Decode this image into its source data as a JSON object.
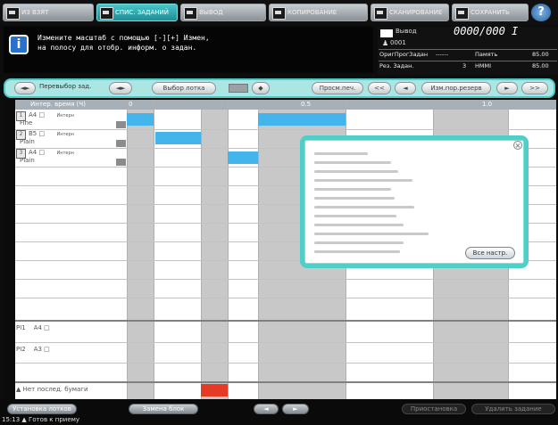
{
  "tabs": [
    {
      "label": "ИЗ ВЗЯТ",
      "active": false
    },
    {
      "label": "СПИС. ЗАДАНИЙ",
      "active": true
    },
    {
      "label": "ВЫВОД",
      "active": false
    },
    {
      "label": "КОПИРОВАНИЕ",
      "active": false
    },
    {
      "label": "СКАНИРОВАНИЕ",
      "active": false
    },
    {
      "label": "СОХРАНИТЬ",
      "active": false
    }
  ],
  "help_label": "?",
  "message": {
    "icon": "i",
    "line1": "Измените масштаб с помощью [-][+] Измен,",
    "line2": "на полосу для отобр. информ. о задан."
  },
  "status": {
    "output_label": "Вывод",
    "output_count": "0000/000 I",
    "user_id": "0001",
    "rows": [
      {
        "label": "ОригПрогЗадан",
        "value": "------",
        "label2": "Память",
        "value2": "85.00"
      },
      {
        "label": "Рез. Задан.",
        "value": "3",
        "label2": "HMMI",
        "value2": "85.00"
      }
    ]
  },
  "toolbar": {
    "reorder_label": "Перевыбор зад.",
    "paper_select_label": "Выбор лотка",
    "preview_label": "Просм.печ.",
    "zoom_label": "Изм.пор.резерв",
    "prev_icon": "arrow-left",
    "next_icon": "arrow-right"
  },
  "grid": {
    "header_label": "Интер. время (Ч)",
    "scale": [
      "0",
      "0.5",
      "1.0"
    ],
    "rows": [
      {
        "num": "1",
        "size": "A4",
        "type": "Fine",
        "tag": "Интерн"
      },
      {
        "num": "2",
        "size": "B5",
        "type": "Plain",
        "tag": "Интерн"
      },
      {
        "num": "3",
        "size": "A4",
        "type": "Plain",
        "tag": "Интерн"
      }
    ],
    "pi_rows": [
      {
        "label": "PI1",
        "size": "A4"
      },
      {
        "label": "PI2",
        "size": "A3"
      }
    ],
    "bottom_row_label": "Нет послед. бумаги",
    "bar_color": "#44b5ec",
    "alert_color": "#e53a23"
  },
  "popup": {
    "details_button": "Все настр."
  },
  "bottom": {
    "left_button": "Установка лотков",
    "mid_button": "Замена блок",
    "scroll_left": "◄",
    "scroll_right": "►",
    "right_button1": "Приостановка",
    "right_button2": "Удалить задание",
    "time": "15:13",
    "status_text": "Готов к приему"
  }
}
